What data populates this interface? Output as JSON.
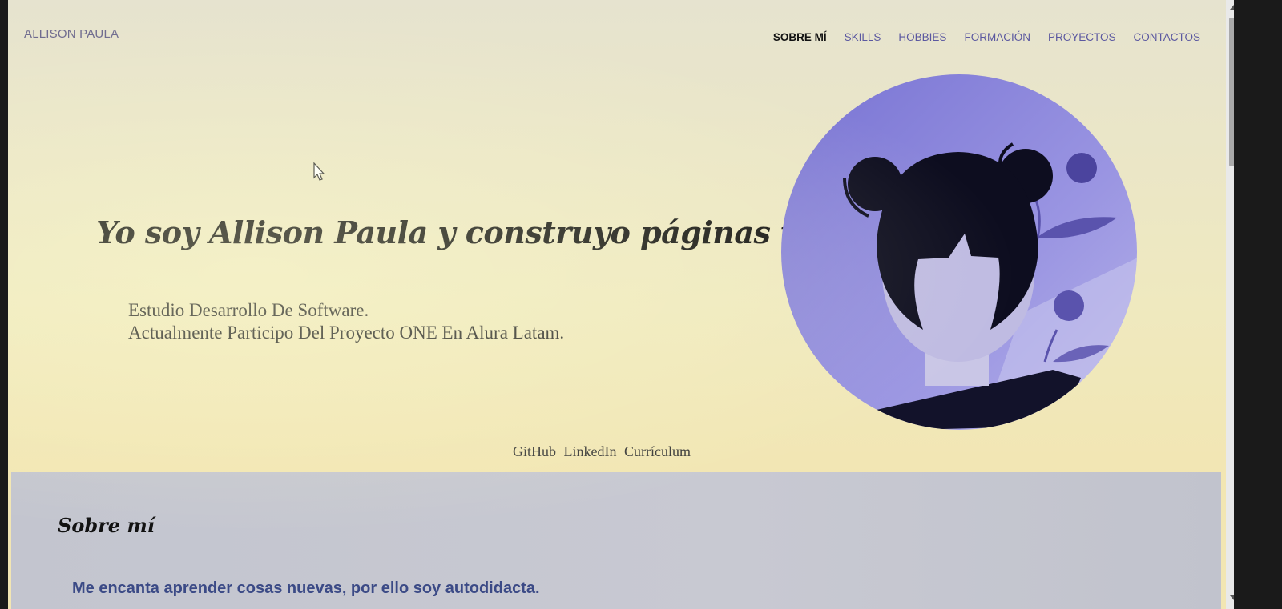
{
  "nav": {
    "brand": "ALLISON PAULA",
    "items": [
      {
        "label": "SOBRE MÍ",
        "active": true
      },
      {
        "label": "SKILLS"
      },
      {
        "label": "HOBBIES"
      },
      {
        "label": "FORMACIÓN"
      },
      {
        "label": "PROYECTOS"
      },
      {
        "label": "CONTACTOS"
      }
    ]
  },
  "hero": {
    "headline": "Yo soy Allison Paula y construyo páginas web.",
    "intro_line1": "Estudio Desarrollo De Software.",
    "intro_line2": "Actualmente Participo Del Proyecto ONE En Alura Latam.",
    "links": [
      "GitHub",
      "LinkedIn",
      "Currículum"
    ],
    "avatar_icon": "girl-avatar-illustration"
  },
  "about": {
    "title": "Sobre mí",
    "text": "Me encanta aprender cosas nuevas, por ello soy autodidacta."
  },
  "colors": {
    "accent": "#5b58a0",
    "avatar_bg": "#8a86d8",
    "about_bg": "#c5c7d0"
  }
}
